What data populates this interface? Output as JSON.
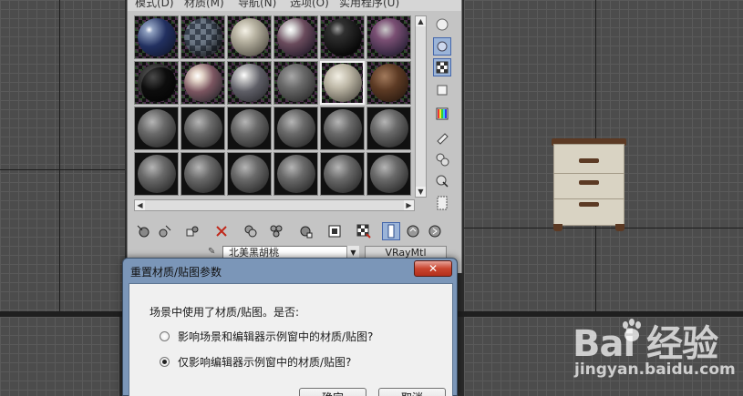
{
  "material_editor": {
    "menu": [
      "模式(D)",
      "材质(M)",
      "导航(N)",
      "选项(O)",
      "实用程序(U)"
    ],
    "material_name": "北美黑胡桃",
    "material_type": "VRayMtl"
  },
  "dialog": {
    "title": "重置材质/贴图参数",
    "close_label": "✕",
    "question": "场景中使用了材质/贴图。是否:",
    "options": [
      {
        "label": "影响场景和编辑器示例窗中的材质/贴图?",
        "checked": false
      },
      {
        "label": "仅影响编辑器示例窗中的材质/贴图?",
        "checked": true
      }
    ],
    "ok_label": "确定",
    "cancel_label": "取消"
  },
  "watermark": {
    "logo_text": "Bai  经验",
    "site": "jingyan.baidu.com"
  },
  "colors": {
    "viewport_bg": "#4c4c4c",
    "editor_bg": "#c4c4c4",
    "dialog_frame": "#7b96b8",
    "close_red": "#c9452f",
    "wood": "#5c3a24"
  }
}
